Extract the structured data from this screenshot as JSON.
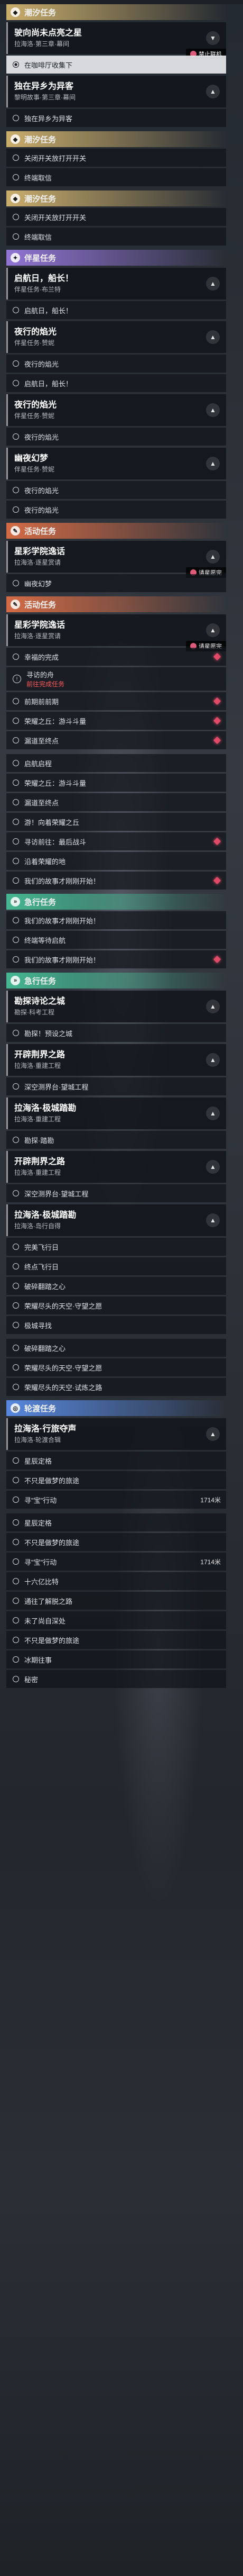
{
  "sections": [
    {
      "type": "cat",
      "style": "tide",
      "label": "潮汐任务",
      "icon": "tide-icon"
    },
    {
      "type": "quest",
      "title": "驶向尚未点亮之星",
      "sub": "拉海洛·第三章·幕间",
      "chev": "▼",
      "badge": "禁止联机"
    },
    {
      "type": "step",
      "text": "在咖啡厅收集下",
      "active": true
    },
    {
      "type": "quest",
      "title": "独在异乡为异客",
      "sub": "黎明故事·第三章·幕间",
      "chev": "▲"
    },
    {
      "type": "step",
      "text": "独在异乡为异客"
    },
    {
      "type": "cat",
      "style": "tide",
      "label": "潮汐任务",
      "icon": "tide-icon"
    },
    {
      "type": "step",
      "text": "关闭开关放打开开关"
    },
    {
      "type": "step",
      "text": "终端取信"
    },
    {
      "type": "cat",
      "style": "tide",
      "label": "潮汐任务",
      "icon": "tide-icon"
    },
    {
      "type": "step",
      "text": "关闭开关放打开开关"
    },
    {
      "type": "step",
      "text": "终端取信"
    },
    {
      "type": "cat",
      "style": "companion",
      "label": "伴星任务",
      "icon": "star-icon"
    },
    {
      "type": "quest",
      "title": "启航日，船长！",
      "sub": "伴星任务·布兰特",
      "chev": "▲"
    },
    {
      "type": "step",
      "text": "启航日，船长！"
    },
    {
      "type": "quest",
      "title": "夜行的焰光",
      "sub": "伴星任务·赞妮",
      "chev": "▲"
    },
    {
      "type": "step",
      "text": "夜行的焰光"
    },
    {
      "type": "step",
      "text": "启航日，船长！"
    },
    {
      "type": "quest",
      "title": "夜行的焰光",
      "sub": "伴星任务·赞妮",
      "chev": "▲"
    },
    {
      "type": "step",
      "text": "夜行的焰光"
    },
    {
      "type": "quest",
      "title": "幽夜幻梦",
      "sub": "伴星任务·赞妮",
      "chev": "▲"
    },
    {
      "type": "step",
      "text": "夜行的焰光"
    },
    {
      "type": "step",
      "text": "夜行的焰光"
    },
    {
      "type": "cat",
      "style": "event",
      "label": "活动任务",
      "icon": "event-icon"
    },
    {
      "type": "quest",
      "title": "星彩学院逸话",
      "sub": "拉海洛·逐星赏请",
      "chev": "▲",
      "badge": "请星愿完"
    },
    {
      "type": "step",
      "text": "幽夜幻梦"
    },
    {
      "type": "cat",
      "style": "event",
      "label": "活动任务",
      "icon": "event-icon"
    },
    {
      "type": "quest",
      "title": "星彩学院逸话",
      "sub": "拉海洛·逐星赏请",
      "chev": "▲",
      "badge": "请星愿完"
    },
    {
      "type": "step",
      "text": "幸福的完成",
      "diamond": true
    },
    {
      "type": "alert",
      "text": "寻访的舟",
      "red": "前往完成任务"
    },
    {
      "type": "step",
      "text": "前期前前期",
      "diamond": true
    },
    {
      "type": "step",
      "text": "荣耀之丘：游斗斗量",
      "diamond": true
    },
    {
      "type": "step",
      "text": "漏道至终点",
      "diamond": true
    },
    {
      "type": "spacer"
    },
    {
      "type": "step",
      "text": "启航启程"
    },
    {
      "type": "step",
      "text": "荣耀之丘：游斗斗量"
    },
    {
      "type": "step",
      "text": "漏道至终点"
    },
    {
      "type": "step",
      "text": "游！向着荣耀之丘"
    },
    {
      "type": "step",
      "text": "寻访前往：最后战斗",
      "diamond": true
    },
    {
      "type": "step",
      "text": "沿着荣耀的地"
    },
    {
      "type": "step",
      "text": "我们的故事才刚刚开始！",
      "diamond": true
    },
    {
      "type": "cat",
      "style": "rapid",
      "label": "急行任务",
      "icon": "rapid-icon"
    },
    {
      "type": "step",
      "text": "我们的故事才刚刚开始！"
    },
    {
      "type": "step",
      "text": "终端等待启航"
    },
    {
      "type": "step",
      "text": "我们的故事才刚刚开始！",
      "diamond": true
    },
    {
      "type": "cat",
      "style": "rapid",
      "label": "急行任务",
      "icon": "rapid-icon"
    },
    {
      "type": "quest",
      "title": "勘探诗论之城",
      "sub": "勘探·科考工程",
      "chev": "▲"
    },
    {
      "type": "step",
      "text": "勘探！预设之城"
    },
    {
      "type": "quest",
      "title": "开辟荆界之路",
      "sub": "拉海洛·重建工程",
      "chev": "▲"
    },
    {
      "type": "step",
      "text": "深空测界台·望城工程"
    },
    {
      "type": "quest",
      "title": "拉海洛·极城踏勘",
      "sub": "拉海洛·重建工程",
      "chev": "▲"
    },
    {
      "type": "step",
      "text": "勘探·踏勘"
    },
    {
      "type": "quest",
      "title": "开辟荆界之路",
      "sub": "拉海洛·重建工程",
      "chev": "▲"
    },
    {
      "type": "step",
      "text": "深空测界台·望城工程"
    },
    {
      "type": "quest",
      "title": "拉海洛·极城踏勘",
      "sub": "拉海洛·岛行自得",
      "chev": "▲"
    },
    {
      "type": "step",
      "text": "完美飞行日"
    },
    {
      "type": "step",
      "text": "终点飞行日"
    },
    {
      "type": "step",
      "text": "破碎翻踏之心"
    },
    {
      "type": "step",
      "text": "荣耀尽头的天空·守望之愿"
    },
    {
      "type": "step",
      "text": "极城寻找"
    },
    {
      "type": "spacer"
    },
    {
      "type": "step",
      "text": "破碎翻踏之心"
    },
    {
      "type": "step",
      "text": "荣耀尽头的天空·守望之愿"
    },
    {
      "type": "step",
      "text": "荣耀尽头的天空·试炼之路"
    },
    {
      "type": "cat",
      "style": "disc",
      "label": "轮渡任务",
      "icon": "disc-icon"
    },
    {
      "type": "quest",
      "title": "拉海洛·行旅夺声",
      "sub": "拉海洛·轮渡合辑",
      "chev": "▲"
    },
    {
      "type": "step",
      "text": "星辰定格"
    },
    {
      "type": "step",
      "text": "不只是做梦的旅途"
    },
    {
      "type": "step",
      "text": "寻\"宝\"行动",
      "dist": "1714米"
    },
    {
      "type": "spacer"
    },
    {
      "type": "step",
      "text": "星辰定格"
    },
    {
      "type": "step",
      "text": "不只是做梦的旅途"
    },
    {
      "type": "step",
      "text": "寻\"宝\"行动",
      "dist": "1714米"
    },
    {
      "type": "step",
      "text": "十六亿比特"
    },
    {
      "type": "step",
      "text": "通往了解脱之路"
    },
    {
      "type": "step",
      "text": "未了尚自深处"
    },
    {
      "type": "step",
      "text": "不只是做梦的旅途"
    },
    {
      "type": "step",
      "text": "冰期往事"
    },
    {
      "type": "step",
      "text": "秘密"
    }
  ]
}
